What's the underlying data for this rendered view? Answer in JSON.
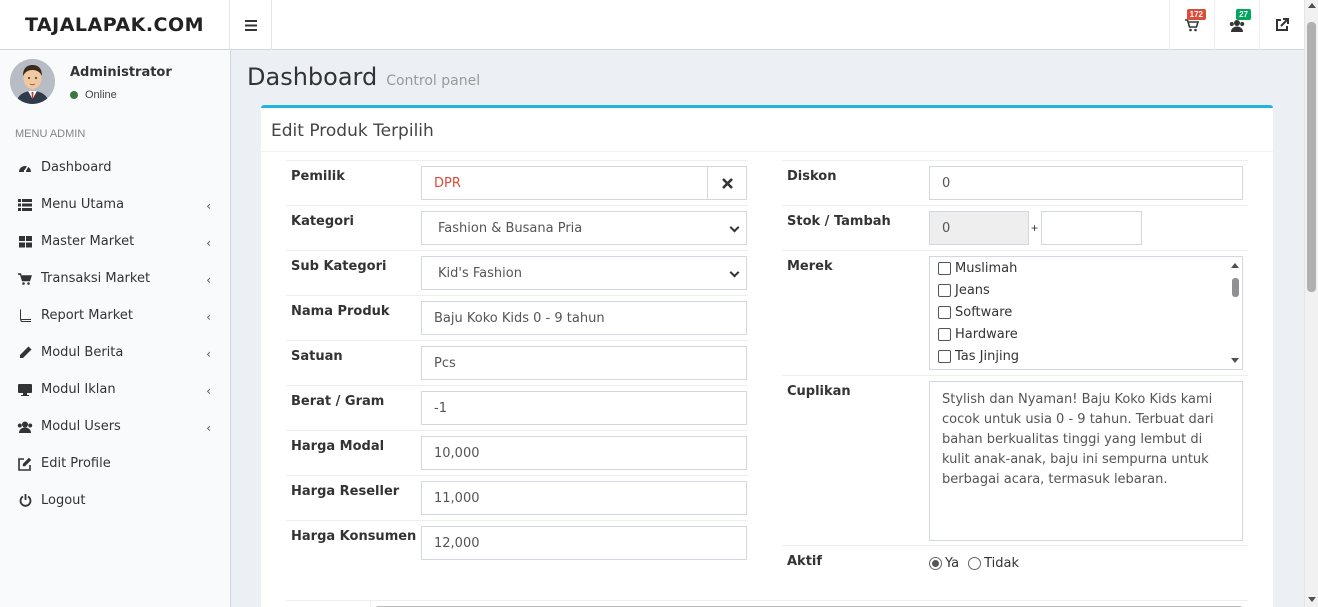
{
  "header": {
    "logo": "TAJALAPAK.COM",
    "menu_toggle_icon": "bars-icon",
    "cart_badge": "172",
    "cart_badge_color": "#dd4b39",
    "users_badge": "27",
    "users_badge_color": "#00a65a"
  },
  "sidebar": {
    "user_name": "Administrator",
    "user_status": "Online",
    "menu_header": "MENU ADMIN",
    "items": [
      {
        "label": "Dashboard",
        "icon": "dashboard-icon",
        "has_caret": false
      },
      {
        "label": "Menu Utama",
        "icon": "list-icon",
        "has_caret": true
      },
      {
        "label": "Master Market",
        "icon": "grid-icon",
        "has_caret": true
      },
      {
        "label": "Transaksi Market",
        "icon": "cart-icon",
        "has_caret": true
      },
      {
        "label": "Report Market",
        "icon": "book-icon",
        "has_caret": true
      },
      {
        "label": "Modul Berita",
        "icon": "pencil-icon",
        "has_caret": true
      },
      {
        "label": "Modul Iklan",
        "icon": "monitor-icon",
        "has_caret": true
      },
      {
        "label": "Modul Users",
        "icon": "users-icon",
        "has_caret": true
      },
      {
        "label": "Edit Profile",
        "icon": "edit-icon",
        "has_caret": false
      },
      {
        "label": "Logout",
        "icon": "power-icon",
        "has_caret": false
      }
    ]
  },
  "page": {
    "title": "Dashboard",
    "subtitle": "Control panel",
    "box_title": "Edit Produk Terpilih"
  },
  "form": {
    "pemilik": {
      "label": "Pemilik",
      "value": "DPR",
      "value_color": "#dd4b39"
    },
    "kategori": {
      "label": "Kategori",
      "value": "Fashion & Busana Pria"
    },
    "sub_kategori": {
      "label": "Sub Kategori",
      "value": "Kid's Fashion"
    },
    "nama_produk": {
      "label": "Nama Produk",
      "value": "Baju Koko Kids 0 - 9 tahun"
    },
    "satuan": {
      "label": "Satuan",
      "value": "Pcs"
    },
    "berat": {
      "label": "Berat / Gram",
      "value": "-1"
    },
    "harga_modal": {
      "label": "Harga Modal",
      "value": "10,000"
    },
    "harga_reseller": {
      "label": "Harga Reseller",
      "value": "11,000"
    },
    "harga_konsumen": {
      "label": "Harga Konsumen",
      "value": "12,000"
    },
    "diskon": {
      "label": "Diskon",
      "value": "0"
    },
    "stok": {
      "label": "Stok / Tambah",
      "value": "0",
      "plus": "+",
      "tambah_value": ""
    },
    "merek": {
      "label": "Merek",
      "options": [
        "Muslimah",
        "Jeans",
        "Software",
        "Hardware",
        "Tas Jinjing"
      ]
    },
    "cuplikan": {
      "label": "Cuplikan",
      "value": "Stylish dan Nyaman! Baju Koko Kids kami cocok untuk usia 0 - 9 tahun. Terbuat dari bahan berkualitas tinggi yang lembut di kulit anak-anak, baju ini sempurna untuk berbagai acara, termasuk lebaran."
    },
    "aktif": {
      "label": "Aktif",
      "option_yes": "Ya",
      "option_no": "Tidak",
      "selected": "Ya"
    }
  }
}
